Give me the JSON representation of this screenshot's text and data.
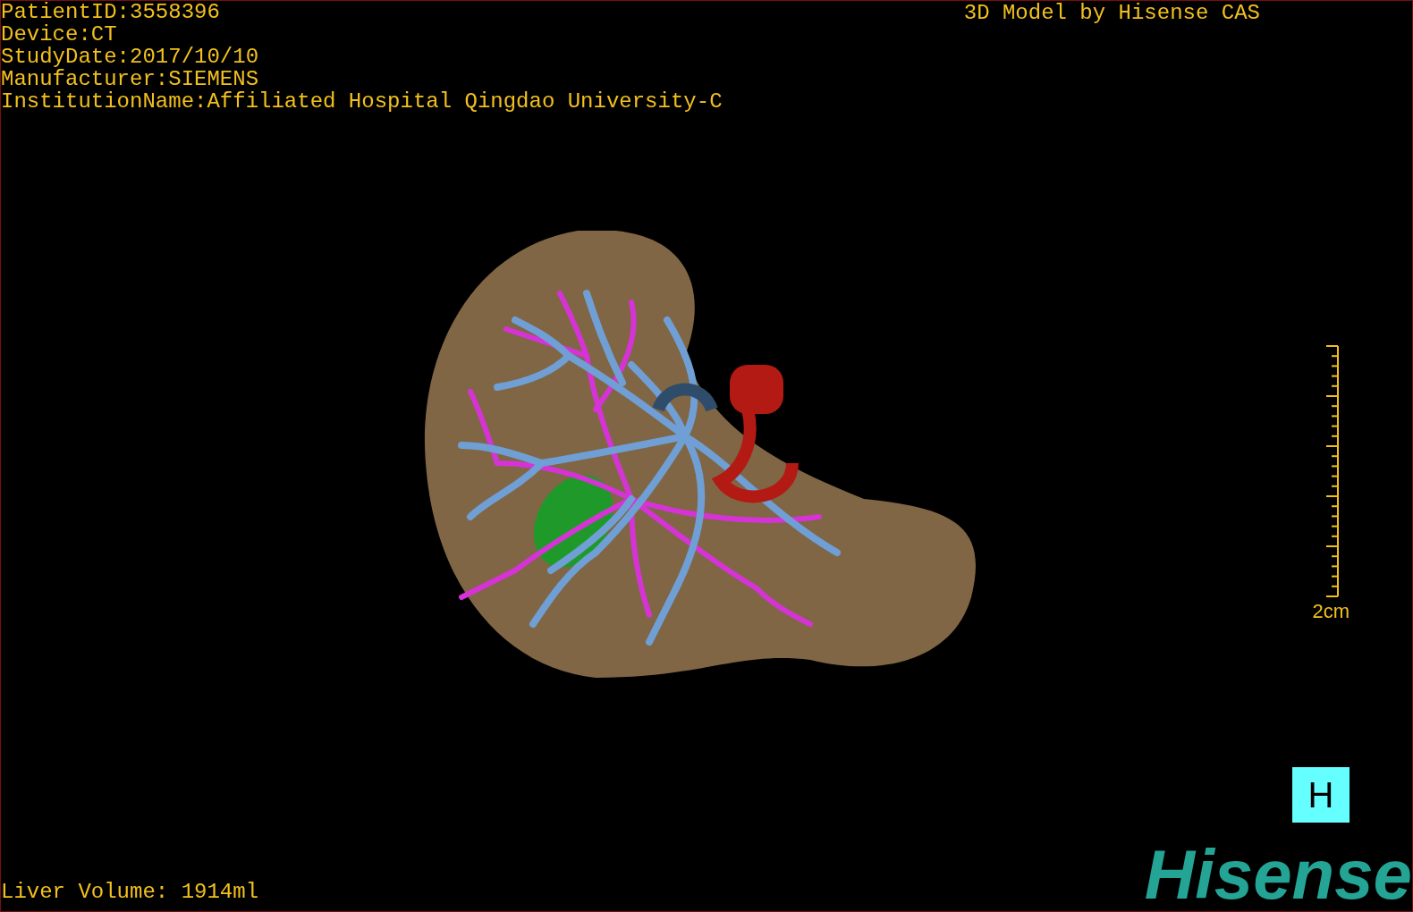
{
  "info_lines": [
    "PatientID:3558396",
    "Device:CT",
    "StudyDate:2017/10/10",
    "Manufacturer:SIEMENS",
    "InstitutionName:Affiliated Hospital Qingdao University-C"
  ],
  "title": "3D Model by Hisense CAS",
  "scale_bar": {
    "label": "2cm"
  },
  "liver_volume": "Liver Volume: 1914ml",
  "view_button": {
    "label": "H"
  },
  "logo": "Hisense"
}
